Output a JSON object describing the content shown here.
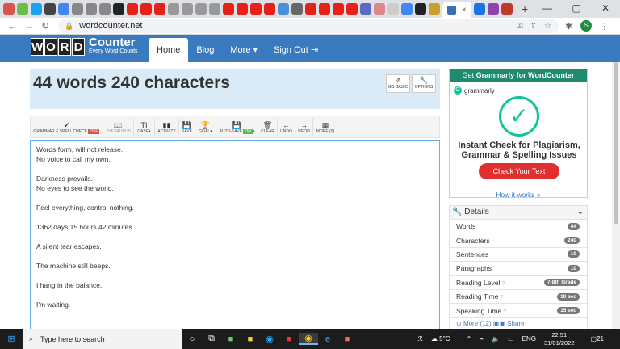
{
  "browser": {
    "tab_close": "×",
    "new_tab": "+",
    "url": "wordcounter.net",
    "window_controls": [
      "—",
      "▢",
      "✕"
    ],
    "profile_initial": "S"
  },
  "site": {
    "logo_letters": [
      "W",
      "O",
      "R",
      "D"
    ],
    "logo_title": "Counter",
    "logo_tagline": "Every Word Counts",
    "nav": {
      "home": "Home",
      "blog": "Blog",
      "more": "More ▾",
      "signout": "Sign Out ⇥"
    }
  },
  "heading": "44 words 240 characters",
  "title_buttons": {
    "go_basic": "GO BASIC",
    "options": "OPTIONS"
  },
  "toolbar": {
    "grammar": "GRAMMAR & SPELL CHECK",
    "grammar_state": "OFF",
    "thesaurus": "THESAURUS",
    "case": "CASE▾",
    "activity": "ACTIVITY",
    "save": "SAVE",
    "goal": "GOAL▾",
    "autosave": "AUTO-SAVE",
    "autosave_state": "ON",
    "clear": "CLEAR",
    "undo": "UNDO",
    "redo": "REDO",
    "more": "MORE (9)"
  },
  "editor_text": "Words form, will not release.\nNo voice to call my own.\n\nDarkness prevails.\nNo eyes to see the world.\n\nFeel everything, control nothing.\n\n1362 days 15 hours 42 minutes.\n\nA silent tear escapes.\n\nThe machine still beeps.\n\nI hang in the balance.\n\nI'm waiting.",
  "ad": {
    "header_prefix": "Get ",
    "header_brand": "Grammarly",
    "header_suffix": " for WordCounter",
    "logo_text": "grammarly",
    "line1": "Instant Check for Plagiarism,",
    "line2": "Grammar & Spelling Issues",
    "button": "Check Your Text"
  },
  "how_it_works": "How it works »",
  "details": {
    "title": "Details",
    "rows": [
      {
        "label": "Words",
        "value": "44"
      },
      {
        "label": "Characters",
        "value": "240"
      },
      {
        "label": "Sentences",
        "value": "10"
      },
      {
        "label": "Paragraphs",
        "value": "10"
      },
      {
        "label": "Reading Level",
        "value": "7-8th Grade"
      },
      {
        "label": "Reading Time",
        "value": "10 sec"
      },
      {
        "label": "Speaking Time",
        "value": "15 sec"
      }
    ],
    "more": "More (12)",
    "share": "Share"
  },
  "taskbar": {
    "search_placeholder": "Type here to search",
    "weather": "5°C",
    "lang": "ENG",
    "time": "22:51",
    "date": "31/01/2022",
    "notif": "21"
  }
}
